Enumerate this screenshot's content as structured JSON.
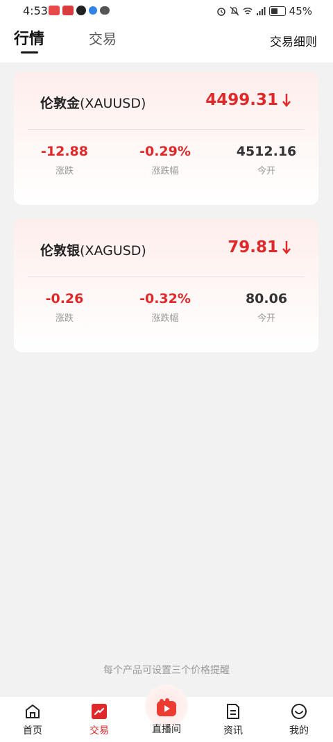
{
  "status_bar": {
    "time": "4:53",
    "battery": "45%"
  },
  "header": {
    "tabs": [
      "行情",
      "交易"
    ],
    "rules_link": "交易细则"
  },
  "products": [
    {
      "name_cn": "伦敦金",
      "symbol": "(XAUUSD)",
      "price": "4499.31",
      "change": "-12.88",
      "change_label": "涨跌",
      "change_pct": "-0.29%",
      "change_pct_label": "涨跌幅",
      "open": "4512.16",
      "open_label": "今开"
    },
    {
      "name_cn": "伦敦银",
      "symbol": "(XAGUSD)",
      "price": "79.81",
      "change": "-0.26",
      "change_label": "涨跌",
      "change_pct": "-0.32%",
      "change_pct_label": "涨跌幅",
      "open": "80.06",
      "open_label": "今开"
    }
  ],
  "hint": "每个产品可设置三个价格提醒",
  "bottom_nav": {
    "items": [
      {
        "label": "首页",
        "icon": "home-icon"
      },
      {
        "label": "交易",
        "icon": "trade-icon",
        "active": true
      },
      {
        "label": "直播间",
        "icon": "live-icon"
      },
      {
        "label": "资讯",
        "icon": "news-icon"
      },
      {
        "label": "我的",
        "icon": "profile-icon"
      }
    ]
  },
  "colors": {
    "accent_red": "#e0282a",
    "background": "#f2f2f2"
  }
}
